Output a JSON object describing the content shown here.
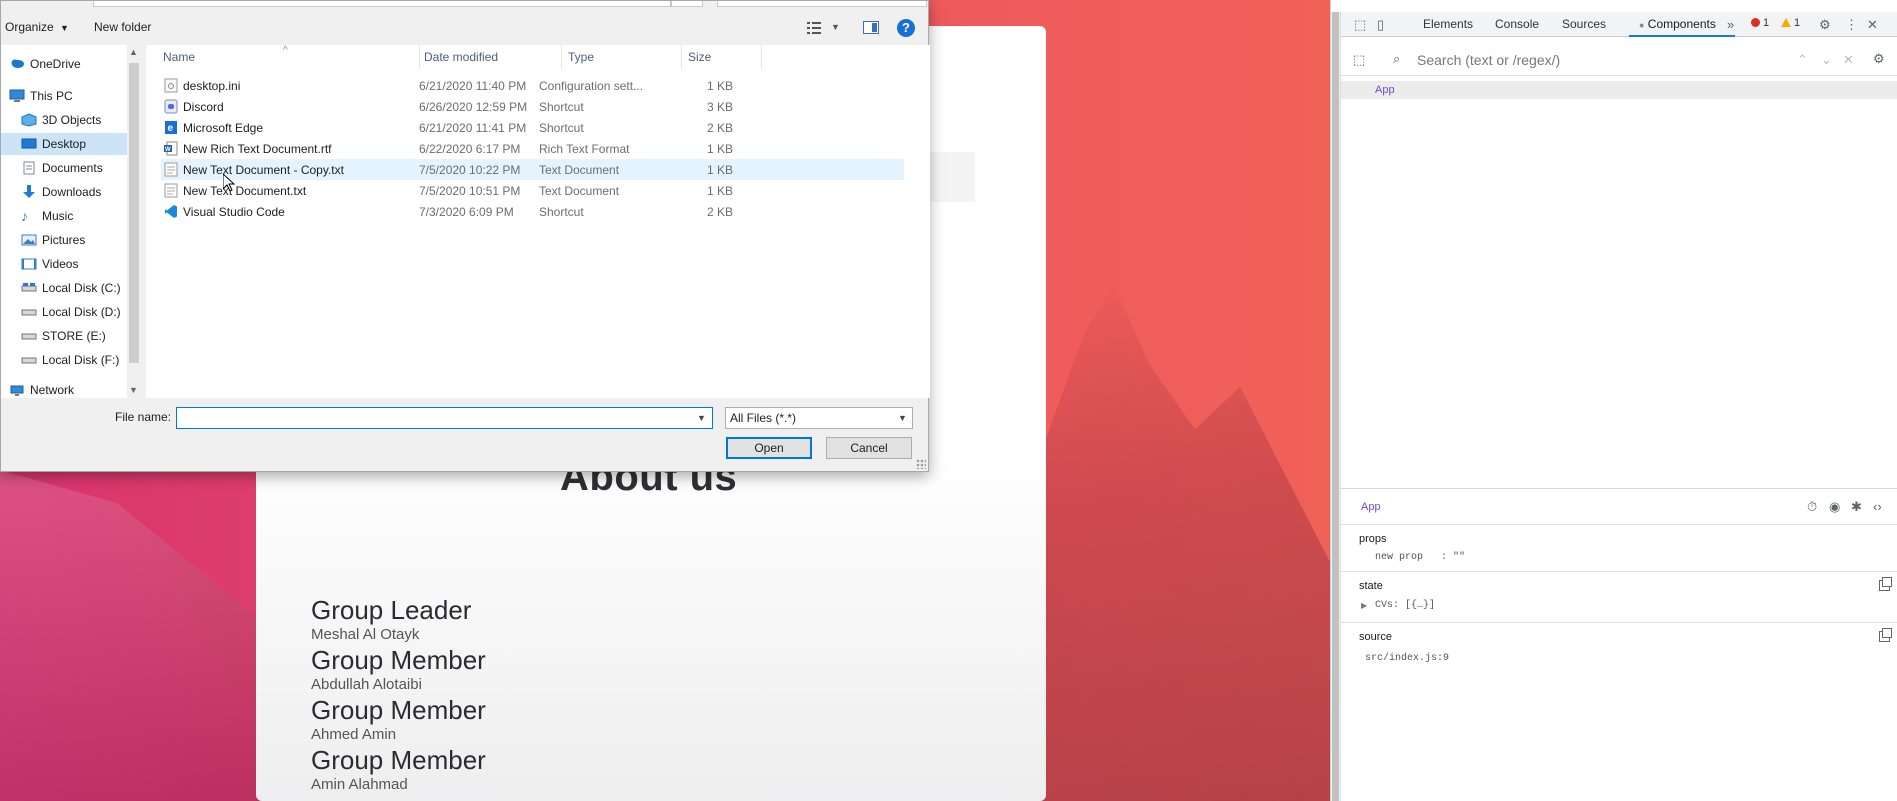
{
  "page": {
    "about_title": "About us",
    "members": [
      {
        "role": "Group Leader",
        "name": "Meshal Al Otayk"
      },
      {
        "role": "Group Member",
        "name": "Abdullah Alotaibi"
      },
      {
        "role": "Group Member",
        "name": "Ahmed Amin"
      },
      {
        "role": "Group Member",
        "name": "Amin Alahmad"
      }
    ]
  },
  "dialog": {
    "toolbar": {
      "organize": "Organize",
      "new_folder": "New folder",
      "help": "?"
    },
    "nav": [
      {
        "label": "OneDrive",
        "icon": "cloud-icon"
      },
      {
        "label": "This PC",
        "icon": "computer-icon"
      },
      {
        "label": "3D Objects",
        "icon": "cube-icon"
      },
      {
        "label": "Desktop",
        "icon": "desktop-icon",
        "selected": true
      },
      {
        "label": "Documents",
        "icon": "document-icon"
      },
      {
        "label": "Downloads",
        "icon": "download-icon"
      },
      {
        "label": "Music",
        "icon": "music-icon"
      },
      {
        "label": "Pictures",
        "icon": "picture-icon"
      },
      {
        "label": "Videos",
        "icon": "video-icon"
      },
      {
        "label": "Local Disk (C:)",
        "icon": "drive-icon"
      },
      {
        "label": "Local Disk (D:)",
        "icon": "drive-icon"
      },
      {
        "label": "STORE (E:)",
        "icon": "drive-icon"
      },
      {
        "label": "Local Disk (F:)",
        "icon": "drive-icon"
      },
      {
        "label": "Network",
        "icon": "network-icon"
      }
    ],
    "columns": {
      "name": "Name",
      "date": "Date modified",
      "type": "Type",
      "size": "Size"
    },
    "files": [
      {
        "name": "desktop.ini",
        "date": "6/21/2020 11:40 PM",
        "type": "Configuration sett...",
        "size": "1 KB",
        "icon": "settings-file-icon"
      },
      {
        "name": "Discord",
        "date": "6/26/2020 12:59 PM",
        "type": "Shortcut",
        "size": "3 KB",
        "icon": "discord-icon"
      },
      {
        "name": "Microsoft Edge",
        "date": "6/21/2020 11:41 PM",
        "type": "Shortcut",
        "size": "2 KB",
        "icon": "edge-icon"
      },
      {
        "name": "New Rich Text Document.rtf",
        "date": "6/22/2020 6:17 PM",
        "type": "Rich Text Format",
        "size": "1 KB",
        "icon": "rtf-file-icon"
      },
      {
        "name": "New Text Document - Copy.txt",
        "date": "7/5/2020 10:22 PM",
        "type": "Text Document",
        "size": "1 KB",
        "icon": "text-file-icon",
        "hover": true
      },
      {
        "name": "New Text Document.txt",
        "date": "7/5/2020 10:51 PM",
        "type": "Text Document",
        "size": "1 KB",
        "icon": "text-file-icon"
      },
      {
        "name": "Visual Studio Code",
        "date": "7/3/2020 6:09 PM",
        "type": "Shortcut",
        "size": "2 KB",
        "icon": "vscode-icon"
      }
    ],
    "file_name_label": "File name:",
    "file_name_value": "",
    "filter": "All Files (*.*)",
    "open": "Open",
    "cancel": "Cancel"
  },
  "devtools": {
    "tabs": [
      "Elements",
      "Console",
      "Sources",
      "Components"
    ],
    "active_tab": "Components",
    "errors": "1",
    "warnings": "1",
    "search_placeholder": "Search (text or /regex/)",
    "tree_root": "App",
    "selected_component": "App",
    "props_title": "props",
    "props_line": "new prop   : \"\"",
    "state_title": "state",
    "state_line": "CVs: [{…}]",
    "source_title": "source",
    "source_line": "src/index.js:9"
  },
  "colors": {
    "accent": "#1a73e8",
    "dialog_selection": "#cce4f7",
    "component_purple": "#6d4bd1",
    "page_gradient_start": "#d8336f",
    "page_gradient_end": "#f06158"
  }
}
